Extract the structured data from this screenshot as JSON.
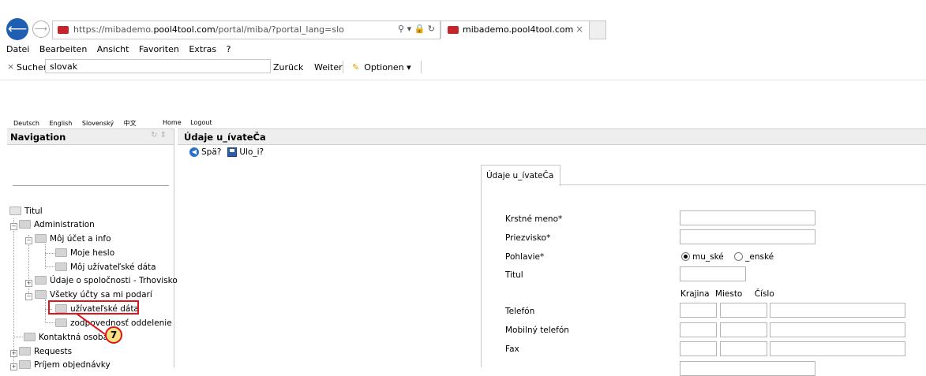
{
  "browser": {
    "url_prefix": "https://mibademo.",
    "url_host": "pool4tool.com",
    "url_suffix": "/portal/miba/?portal_lang=slo",
    "address_icons": "⚲ ▾ 🔒 ↻",
    "tab_title": "mibademo.pool4tool.com",
    "tab_close": "×",
    "menu": [
      "Datei",
      "Bearbeiten",
      "Ansicht",
      "Favoriten",
      "Extras",
      "?"
    ],
    "find": {
      "close": "×",
      "label": "Suchen:",
      "value": "slovak",
      "back": "Zurück",
      "next": "Weiter",
      "options": "Optionen ▾"
    }
  },
  "languages": [
    "Deutsch",
    "English",
    "Slovenský",
    "中文"
  ],
  "top_links": [
    "Home",
    "Logout"
  ],
  "navigation": {
    "title": "Navigation",
    "tree": [
      {
        "label": "Titul"
      },
      {
        "label": "Administration"
      },
      {
        "label": "Môj účet a info"
      },
      {
        "label": "Moje heslo"
      },
      {
        "label": "Môj užívateľské dáta"
      },
      {
        "label": "Údaje o spoločnosti - Trhovisko"
      },
      {
        "label": "Všetky účty sa mi podarí"
      },
      {
        "label": "užívateľské dáta"
      },
      {
        "label": "zodpovednosť oddelenie"
      },
      {
        "label": "Kontaktná osoba"
      },
      {
        "label": "Requests"
      },
      {
        "label": "Príjem objednávky"
      }
    ]
  },
  "callout": {
    "number": "7"
  },
  "main": {
    "title": "Údaje u_ívateČa",
    "toolbar": {
      "back_label": "Spä?",
      "save_label": "Ulo_i?"
    },
    "form_tab": "Údaje u_ívateČa",
    "fields": {
      "first_name": "Krstné meno*",
      "last_name": "Priezvisko*",
      "gender": "Pohlavie*",
      "title": "Titul",
      "phone": "Telefón",
      "mobile": "Mobilný telefón",
      "fax": "Fax"
    },
    "gender_options": {
      "male": "mu_ské",
      "female": "_enské",
      "selected": "male"
    },
    "phone_columns": {
      "country": "Krajina",
      "area": "Miesto",
      "number": "Číslo"
    }
  }
}
